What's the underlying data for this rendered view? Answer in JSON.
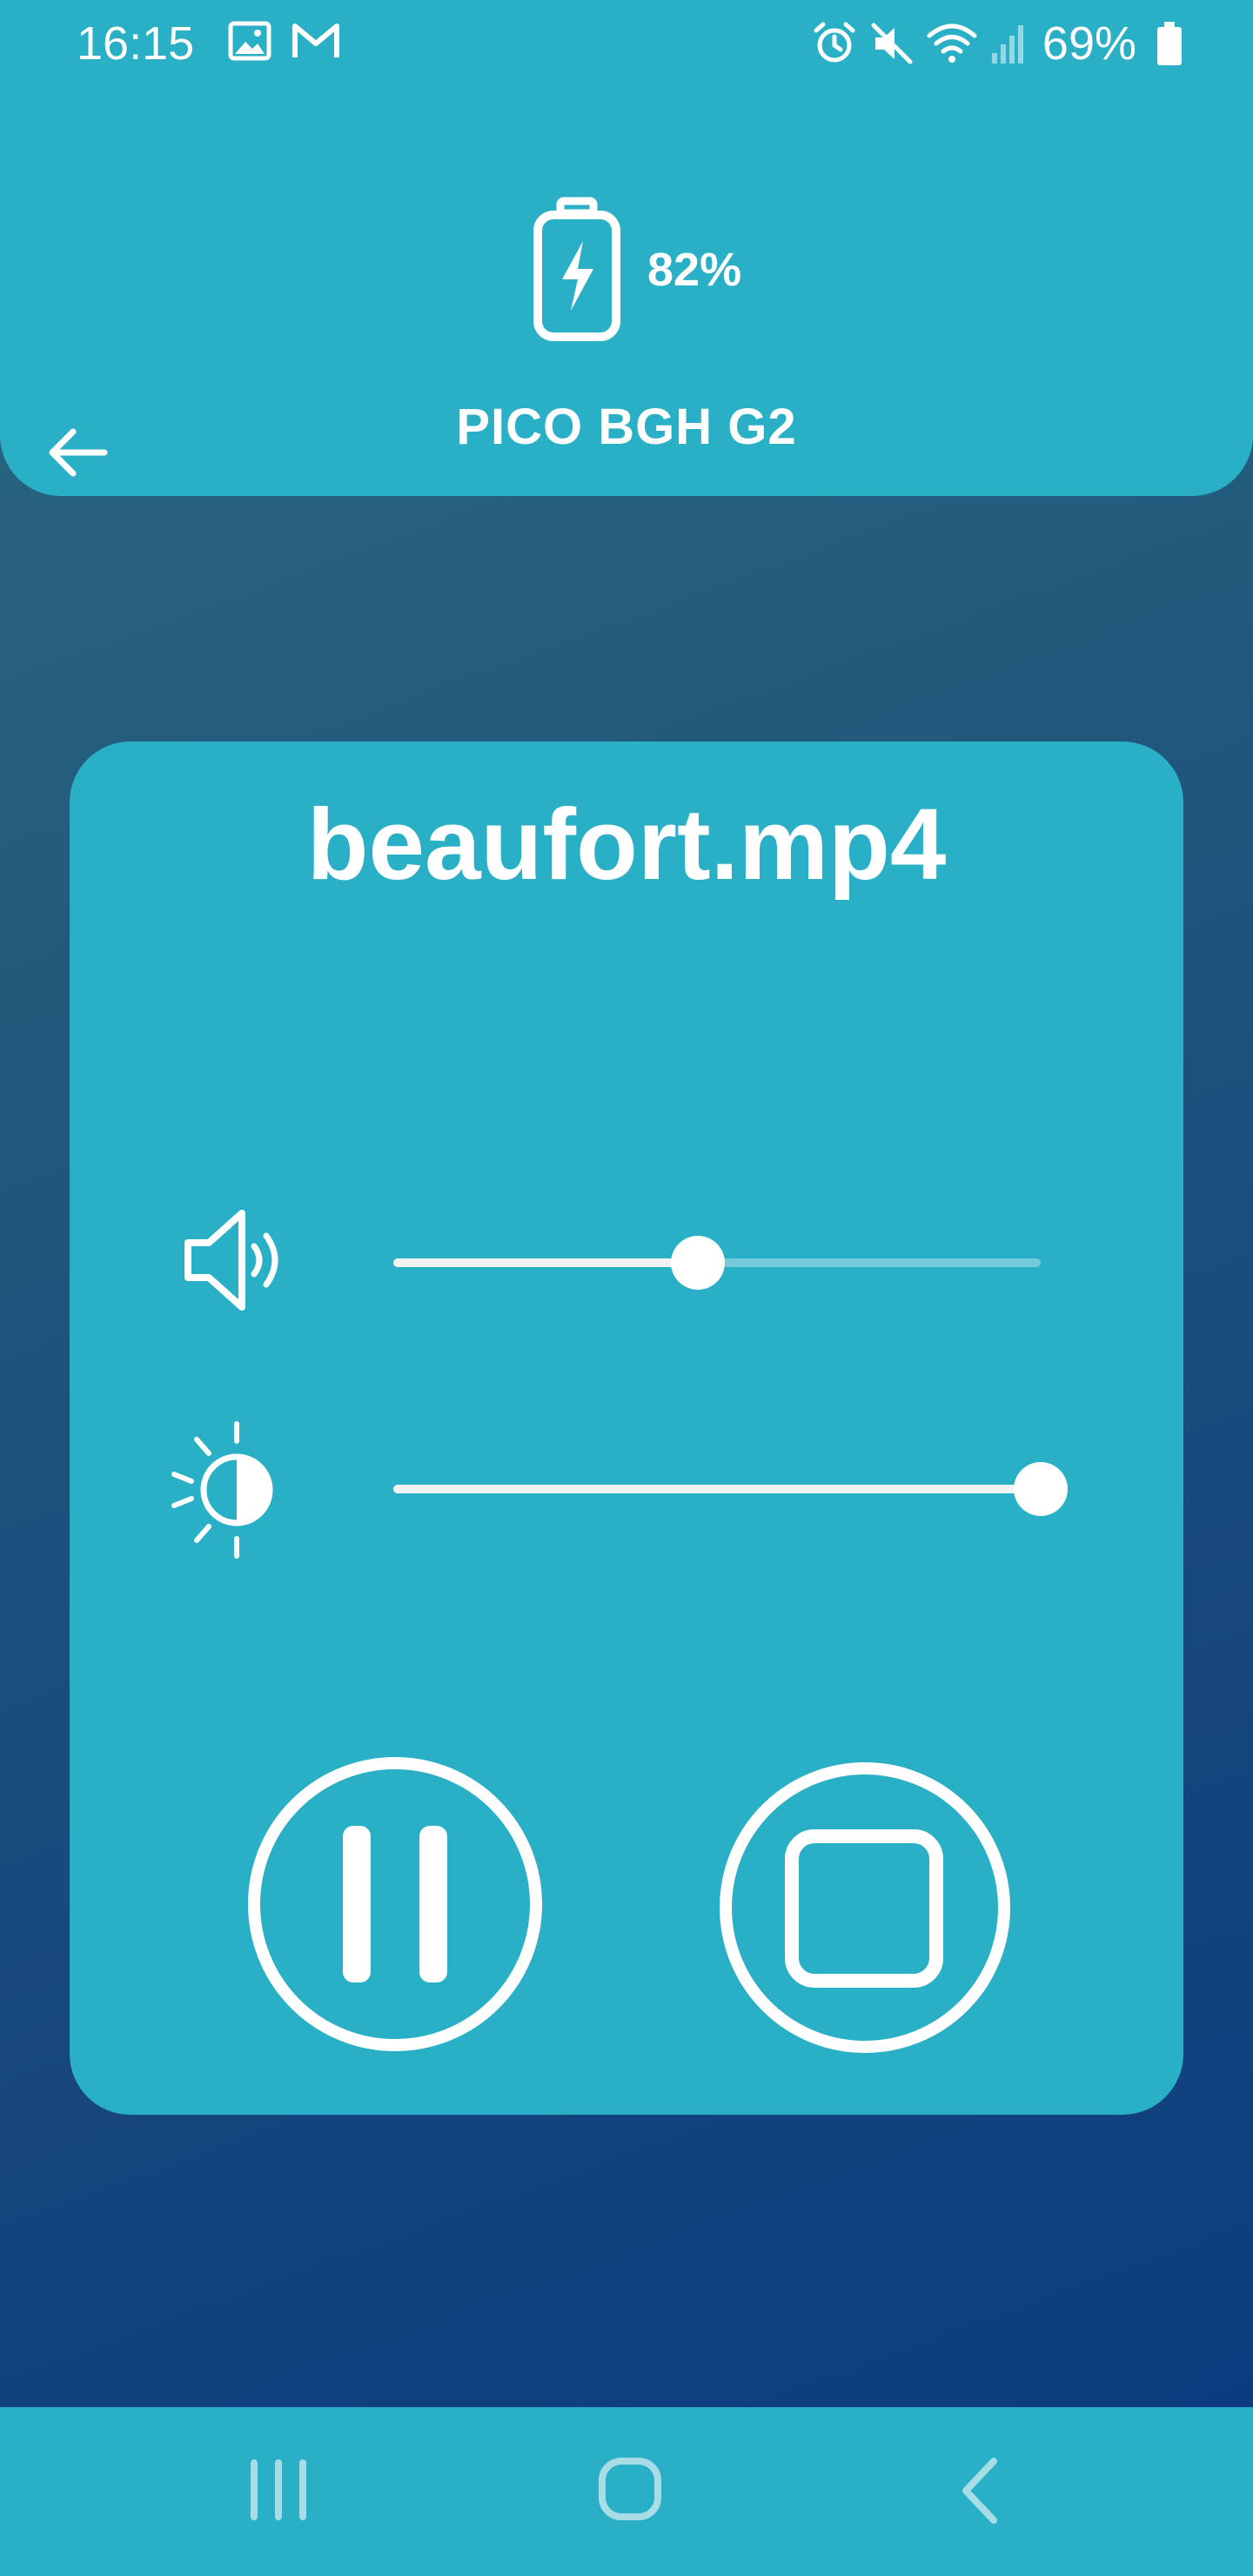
{
  "status_bar": {
    "time": "16:15",
    "battery": "69%",
    "left_icons": [
      "image-icon",
      "gmail-icon"
    ],
    "right_icons": [
      "alarm-icon",
      "mute-icon",
      "wifi-icon",
      "signal-icon",
      "battery-icon"
    ]
  },
  "header": {
    "device_battery": "82%",
    "device_name": "PICO BGH G2",
    "back_icon": "arrow-left-icon"
  },
  "player": {
    "file_name": "beaufort.mp4",
    "volume": {
      "icon": "speaker-icon",
      "level": 0.47
    },
    "brightness": {
      "icon": "brightness-icon",
      "level": 1.0
    },
    "pause_icon": "pause-icon",
    "stop_icon": "stop-icon"
  },
  "nav_bar": {
    "icons": [
      "recent-apps-icon",
      "home-icon",
      "back-icon"
    ]
  },
  "colors": {
    "accent": "#29afc6",
    "background_top": "#2a6b80",
    "background_bottom": "#0a3a80",
    "foreground": "#ffffff"
  }
}
